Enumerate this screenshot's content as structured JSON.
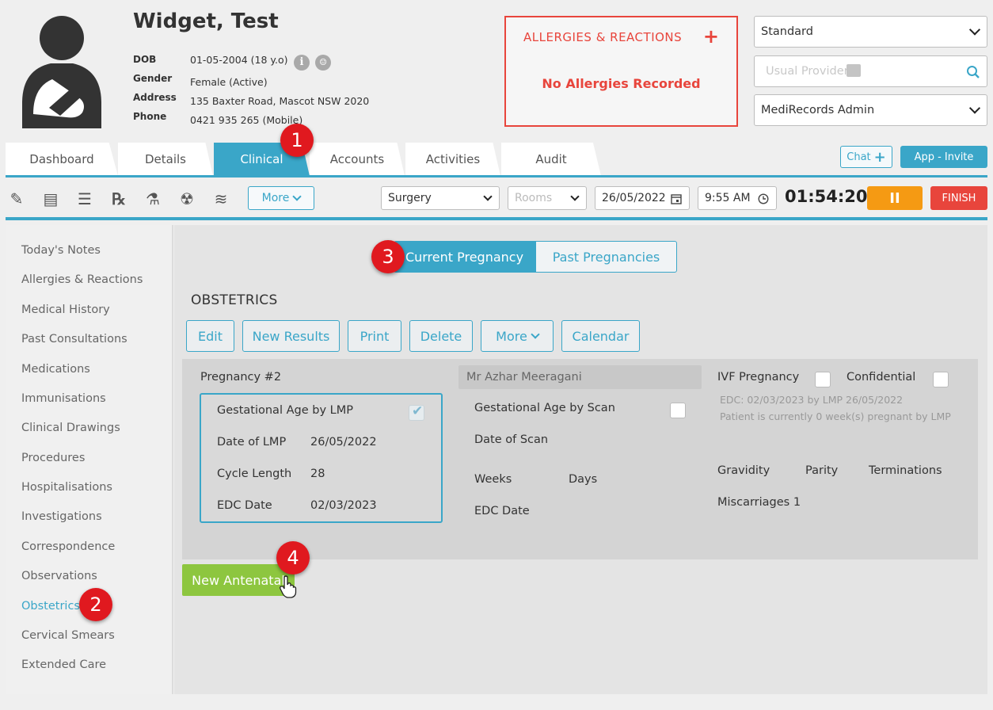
{
  "patient": {
    "name": "Widget, Test",
    "fields": [
      {
        "label": "DOB",
        "value": "01-05-2004 (18 y.o)"
      },
      {
        "label": "Gender",
        "value": "Female (Active)"
      },
      {
        "label": "Address",
        "value": "135 Baxter Road, Mascot NSW 2020"
      },
      {
        "label": "Phone",
        "value": "0421 935 265 (Mobile)"
      }
    ]
  },
  "allergies": {
    "title": "ALLERGIES & REACTIONS",
    "plus": "+",
    "status": "No Allergies Recorded"
  },
  "header_selects": {
    "billing": "Standard",
    "usual_provider_placeholder": "Usual Provider",
    "user": "MediRecords Admin"
  },
  "tabs": [
    "Dashboard",
    "Details",
    "Clinical",
    "Accounts",
    "Activities",
    "Audit"
  ],
  "active_tab": "Clinical",
  "chat_label": "Chat",
  "invite_label": "App - Invite",
  "toolbar": {
    "more_label": "More",
    "location": "Surgery",
    "rooms_placeholder": "Rooms",
    "date": "26/05/2022",
    "time": "9:55 AM",
    "timer": "01:54:20",
    "pause": "II",
    "finish": "FINISH"
  },
  "sidenav": [
    "Today's Notes",
    "Allergies & Reactions",
    "Medical History",
    "Past Consultations",
    "Medications",
    "Immunisations",
    "Clinical Drawings",
    "Procedures",
    "Hospitalisations",
    "Investigations",
    "Correspondence",
    "Observations",
    "Obstetrics",
    "Cervical Smears",
    "Extended Care"
  ],
  "active_nav": "Obstetrics",
  "pregnancy_toggle": {
    "current": "Current Pregnancy",
    "past": "Past Pregnancies"
  },
  "section_title": "OBSTETRICS",
  "actions": {
    "edit": "Edit",
    "new_results": "New Results",
    "print": "Print",
    "delete": "Delete",
    "more": "More",
    "calendar": "Calendar"
  },
  "pregnancy": {
    "title": "Pregnancy #2",
    "provider": "Mr Azhar Meeragani",
    "lmp_box": {
      "heading": "Gestational Age by LMP",
      "checked": true,
      "date_of_lmp_label": "Date of LMP",
      "date_of_lmp": "26/05/2022",
      "cycle_length_label": "Cycle Length",
      "cycle_length": "28",
      "edc_label": "EDC Date",
      "edc": "02/03/2023"
    },
    "scan": {
      "heading": "Gestational Age by Scan",
      "checked": false,
      "date_of_scan_label": "Date of Scan",
      "weeks_label": "Weeks",
      "days_label": "Days",
      "edc_label": "EDC Date"
    },
    "ivf_label": "IVF Pregnancy",
    "confidential_label": "Confidential",
    "edc_note": "EDC: 02/03/2023 by LMP 26/05/2022",
    "status_note": "Patient is currently 0 week(s) pregnant by LMP",
    "gravidity_label": "Gravidity",
    "parity_label": "Parity",
    "terminations_label": "Terminations",
    "miscarriages_label": "Miscarriages 1"
  },
  "new_antenatal": "New Antenatal",
  "step_badges": [
    "1",
    "2",
    "3",
    "4"
  ],
  "colors": {
    "accent": "#3aa6c8",
    "danger": "#e8453c",
    "warning": "#f59a13",
    "success": "#8dc63f",
    "badge": "#e0191f"
  }
}
